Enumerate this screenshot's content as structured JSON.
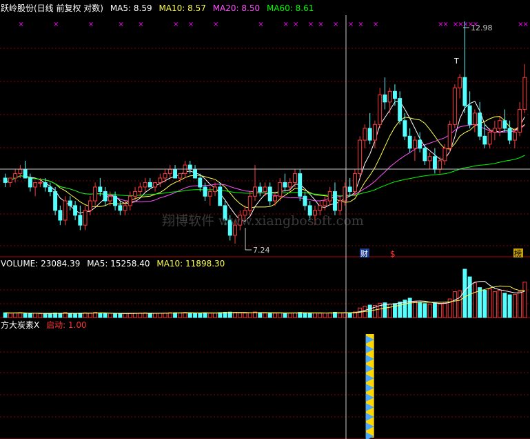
{
  "header": {
    "stock_title": "跃岭股份(日线 前复权 对数)",
    "ma5_label": "MA5: 8.59",
    "ma10_label": "MA10: 8.57",
    "ma20_label": "MA20: 8.50",
    "ma60_label": "MA60: 8.61"
  },
  "volume_header": {
    "volume_label": "VOLUME: 23084.39",
    "ma5_label": "MA5: 15258.40",
    "ma10_label": "MA10: 11898.30"
  },
  "indicator_header": {
    "name_label": "方大炭素X",
    "signal_label": "启动: 1.00"
  },
  "annotations": {
    "high_price": "12.98",
    "low_price": "7.24",
    "watermark": "翔博软件 www.xiangbosoft.com",
    "event_cai": "财",
    "event_s": "$",
    "event_bang": "榜",
    "t_marker": "T"
  },
  "colors": {
    "up": "#ff3c3c",
    "down": "#54ffff",
    "ma5": "#ffffff",
    "ma10": "#ffff4f",
    "ma20": "#ff54ff",
    "ma60": "#00ff00",
    "grid": "#8b0000",
    "text": "#ffffff",
    "header_yellow": "#ffff00",
    "signal_red": "#ff3030",
    "x_marker": "#ff00ff"
  },
  "chart_data": [
    {
      "type": "candlestick",
      "title": "跃岭股份(日线 前复权 对数)",
      "scale": "log",
      "ylim": [
        7.2,
        13.0
      ],
      "annotations": {
        "max": 12.98,
        "min": 7.24
      },
      "ohlc": [
        [
          8.6,
          8.7,
          8.4,
          8.5
        ],
        [
          8.5,
          8.6,
          8.4,
          8.6
        ],
        [
          8.6,
          8.8,
          8.5,
          8.7
        ],
        [
          8.7,
          8.9,
          8.6,
          8.8
        ],
        [
          8.8,
          9.0,
          8.6,
          8.6
        ],
        [
          8.6,
          8.7,
          8.3,
          8.4
        ],
        [
          8.4,
          8.5,
          8.2,
          8.5
        ],
        [
          8.5,
          8.6,
          8.4,
          8.5
        ],
        [
          8.5,
          8.6,
          8.3,
          8.4
        ],
        [
          8.4,
          8.5,
          8.2,
          8.3
        ],
        [
          8.3,
          8.4,
          7.8,
          7.9
        ],
        [
          7.9,
          8.0,
          7.6,
          7.7
        ],
        [
          7.7,
          8.2,
          7.6,
          8.1
        ],
        [
          8.1,
          8.2,
          7.9,
          8.0
        ],
        [
          8.0,
          8.1,
          7.7,
          7.8
        ],
        [
          7.8,
          8.0,
          7.5,
          7.6
        ],
        [
          7.6,
          8.0,
          7.5,
          7.9
        ],
        [
          7.9,
          8.2,
          7.8,
          8.1
        ],
        [
          8.1,
          8.5,
          8.0,
          8.4
        ],
        [
          8.4,
          8.6,
          8.2,
          8.3
        ],
        [
          8.3,
          8.4,
          8.0,
          8.1
        ],
        [
          8.1,
          8.3,
          8.0,
          8.2
        ],
        [
          8.2,
          8.3,
          7.9,
          8.0
        ],
        [
          8.0,
          8.1,
          7.8,
          7.9
        ],
        [
          7.9,
          8.1,
          7.8,
          8.0
        ],
        [
          8.0,
          8.3,
          7.9,
          8.2
        ],
        [
          8.2,
          8.4,
          8.1,
          8.3
        ],
        [
          8.3,
          8.5,
          8.2,
          8.4
        ],
        [
          8.4,
          8.6,
          8.3,
          8.5
        ],
        [
          8.5,
          8.6,
          8.4,
          8.4
        ],
        [
          8.4,
          8.5,
          8.3,
          8.5
        ],
        [
          8.5,
          8.7,
          8.4,
          8.6
        ],
        [
          8.6,
          8.8,
          8.5,
          8.7
        ],
        [
          8.7,
          8.9,
          8.6,
          8.8
        ],
        [
          8.8,
          8.9,
          8.6,
          8.6
        ],
        [
          8.6,
          8.7,
          8.5,
          8.7
        ],
        [
          8.7,
          9.0,
          8.6,
          8.9
        ],
        [
          8.9,
          9.0,
          8.7,
          8.8
        ],
        [
          8.8,
          8.9,
          8.6,
          8.6
        ],
        [
          8.6,
          8.7,
          8.3,
          8.4
        ],
        [
          8.4,
          8.5,
          8.1,
          8.2
        ],
        [
          8.2,
          8.4,
          8.0,
          8.3
        ],
        [
          8.3,
          8.5,
          8.2,
          8.4
        ],
        [
          8.4,
          8.5,
          8.0,
          8.0
        ],
        [
          8.0,
          8.1,
          7.6,
          7.7
        ],
        [
          7.7,
          7.8,
          7.3,
          7.4
        ],
        [
          7.4,
          7.7,
          7.24,
          7.6
        ],
        [
          7.6,
          7.9,
          7.5,
          7.8
        ],
        [
          7.8,
          8.0,
          7.7,
          7.9
        ],
        [
          7.9,
          8.3,
          7.8,
          8.2
        ],
        [
          8.2,
          8.9,
          8.1,
          8.4
        ],
        [
          8.4,
          8.5,
          8.2,
          8.3
        ],
        [
          8.3,
          8.5,
          8.2,
          8.4
        ],
        [
          8.4,
          8.5,
          8.0,
          8.1
        ],
        [
          8.1,
          8.3,
          8.0,
          8.2
        ],
        [
          8.2,
          8.6,
          8.1,
          8.5
        ],
        [
          8.5,
          8.7,
          8.3,
          8.4
        ],
        [
          8.4,
          8.6,
          8.3,
          8.5
        ],
        [
          8.5,
          8.8,
          8.4,
          8.7
        ],
        [
          8.7,
          8.8,
          8.1,
          8.2
        ],
        [
          8.2,
          8.3,
          7.9,
          8.0
        ],
        [
          8.0,
          8.1,
          7.7,
          7.8
        ],
        [
          7.8,
          8.0,
          7.6,
          7.9
        ],
        [
          7.9,
          8.1,
          7.8,
          8.0
        ],
        [
          8.0,
          8.2,
          7.9,
          8.1
        ],
        [
          8.1,
          8.4,
          8.0,
          8.3
        ],
        [
          8.3,
          8.5,
          7.8,
          7.9
        ],
        [
          7.9,
          8.2,
          7.8,
          8.1
        ],
        [
          8.1,
          8.5,
          8.0,
          8.4
        ],
        [
          8.4,
          8.6,
          8.2,
          8.3
        ],
        [
          8.3,
          8.8,
          8.2,
          8.7
        ],
        [
          8.7,
          9.6,
          8.6,
          9.5
        ],
        [
          9.5,
          9.9,
          9.3,
          9.8
        ],
        [
          9.8,
          10.2,
          9.4,
          9.5
        ],
        [
          9.5,
          10.0,
          9.3,
          9.9
        ],
        [
          9.9,
          10.9,
          9.8,
          10.7
        ],
        [
          10.7,
          11.2,
          10.3,
          10.5
        ],
        [
          10.5,
          10.9,
          10.2,
          10.8
        ],
        [
          10.8,
          11.0,
          10.4,
          10.6
        ],
        [
          10.6,
          10.8,
          9.9,
          10.0
        ],
        [
          10.0,
          10.2,
          9.5,
          9.6
        ],
        [
          9.6,
          9.8,
          9.2,
          9.3
        ],
        [
          9.3,
          9.6,
          9.0,
          9.5
        ],
        [
          9.5,
          9.7,
          9.2,
          9.3
        ],
        [
          9.3,
          9.4,
          8.9,
          9.0
        ],
        [
          9.0,
          9.2,
          8.8,
          9.1
        ],
        [
          9.1,
          9.3,
          8.7,
          8.8
        ],
        [
          8.8,
          9.1,
          8.7,
          9.0
        ],
        [
          9.0,
          9.4,
          8.9,
          9.3
        ],
        [
          9.3,
          10.0,
          9.2,
          9.9
        ],
        [
          9.9,
          11.0,
          9.8,
          10.9
        ],
        [
          10.9,
          11.3,
          10.6,
          11.2
        ],
        [
          11.2,
          12.98,
          10.2,
          10.4
        ],
        [
          10.4,
          10.8,
          9.8,
          9.9
        ],
        [
          9.9,
          10.3,
          9.7,
          10.2
        ],
        [
          10.2,
          10.5,
          9.5,
          9.6
        ],
        [
          9.6,
          9.9,
          9.3,
          9.4
        ],
        [
          9.4,
          9.8,
          9.3,
          9.7
        ],
        [
          9.7,
          10.0,
          9.5,
          9.8
        ],
        [
          9.8,
          10.1,
          9.6,
          10.0
        ],
        [
          10.0,
          10.3,
          9.7,
          9.8
        ],
        [
          9.8,
          10.0,
          9.4,
          9.5
        ],
        [
          9.5,
          9.8,
          9.3,
          9.7
        ],
        [
          9.7,
          10.5,
          9.6,
          10.3
        ],
        [
          10.3,
          11.6,
          10.2,
          11.2
        ]
      ],
      "ma": {
        "MA5": 8.59,
        "MA10": 8.57,
        "MA20": 8.5,
        "MA60": 8.61
      },
      "markers": [
        {
          "label": "财",
          "index": 74
        },
        {
          "label": "$",
          "index": 81
        },
        {
          "label": "榜",
          "index": 104
        }
      ]
    },
    {
      "type": "bar",
      "title": "VOLUME",
      "series": [
        {
          "name": "VOLUME",
          "values": [
            3100,
            2800,
            3000,
            3200,
            2700,
            2600,
            2900,
            2500,
            2400,
            2700,
            3000,
            2800,
            3300,
            2600,
            2500,
            2900,
            3100,
            3000,
            3400,
            2900,
            2600,
            2700,
            2500,
            2400,
            2600,
            2800,
            2900,
            3000,
            3100,
            2800,
            2700,
            2900,
            3000,
            3200,
            3100,
            2900,
            3300,
            3000,
            2800,
            2900,
            3100,
            2800,
            2900,
            3200,
            3400,
            3500,
            3300,
            3000,
            2900,
            3100,
            3600,
            3000,
            2900,
            3000,
            2800,
            3100,
            2900,
            2800,
            3000,
            3300,
            3100,
            3000,
            2900,
            2800,
            2900,
            3100,
            3400,
            3000,
            3200,
            3100,
            3600,
            6200,
            7400,
            8100,
            7900,
            9300,
            9600,
            8800,
            9100,
            10100,
            11400,
            12600,
            10300,
            9700,
            9100,
            8800,
            9400,
            8900,
            9800,
            12100,
            16900,
            17400,
            31500,
            26500,
            22600,
            19500,
            17800,
            18600,
            16900,
            17800,
            15900,
            14800,
            15100,
            16800,
            23084
          ]
        }
      ],
      "ma": {
        "MA5": 15258.4,
        "MA10": 11898.3
      }
    },
    {
      "type": "bar",
      "title": "方大炭素X",
      "series": [
        {
          "name": "启动",
          "values_at": [
            {
              "index": 73,
              "value": 1.0
            }
          ]
        }
      ]
    }
  ]
}
